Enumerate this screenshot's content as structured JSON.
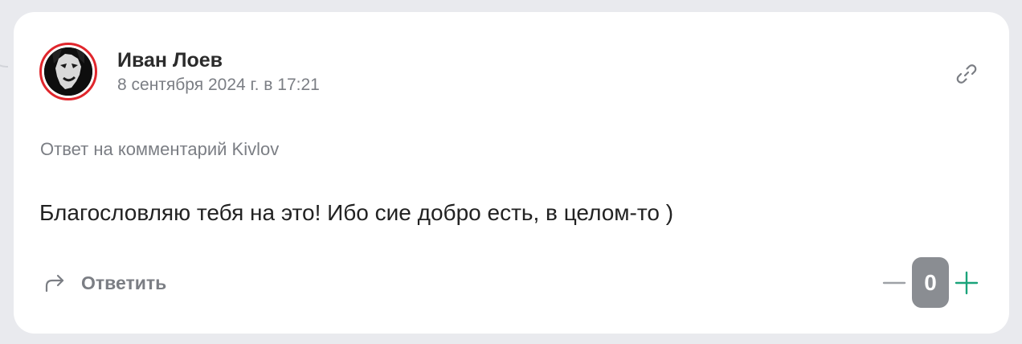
{
  "comment": {
    "author": {
      "name": "Иван Лоев",
      "avatar": "avatar-image"
    },
    "timestamp": "8 сентября 2024 г. в 17:21",
    "reply_to": "Ответ на комментарий Kivlov",
    "text": "Благословляю тебя на это! Ибо сие добро есть, в целом-то )",
    "actions": {
      "reply_label": "Ответить",
      "reply_icon": "reply-arrow-icon",
      "link_icon": "link-icon"
    },
    "vote": {
      "score": "0",
      "downvote_icon": "minus-icon",
      "upvote_icon": "plus-icon"
    }
  },
  "colors": {
    "page_background": "#e9eaee",
    "card_background": "#ffffff",
    "avatar_ring": "#e0262c",
    "muted_text": "#7b7e84",
    "score_badge": "#8a8d92",
    "upvote": "#1aa37a",
    "downvote": "#9ea1a6"
  }
}
